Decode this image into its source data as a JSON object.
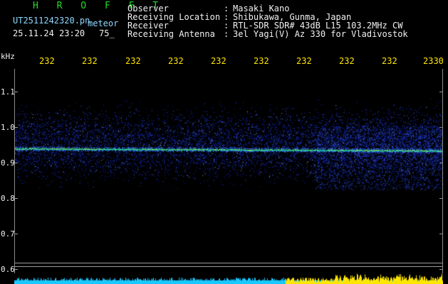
{
  "header": {
    "station_code": "H R O F F T",
    "filename": "UT2511242320.pn",
    "mode": "meteor",
    "datetime": "25.11.24 23:20",
    "count": "75_",
    "fields": [
      {
        "label": "Observer",
        "value": "Masaki Kano"
      },
      {
        "label": "Receiving Location",
        "value": "Shibukawa, Gunma, Japan"
      },
      {
        "label": "Receiver",
        "value": "RTL-SDR SDR# 43dB L15 103.2MHz CW"
      },
      {
        "label": "Receiving Antenna",
        "value": "3el Yagi(V) Az 330 for Vladivostok"
      }
    ],
    "separator": ":"
  },
  "axis": {
    "unit": "kHz",
    "y_ticks": [
      "1.1",
      "1.0",
      "0.9",
      "0.8",
      "0.7",
      "0.6"
    ],
    "time_ticks": [
      "232",
      "232",
      "232",
      "232",
      "232",
      "232",
      "232",
      "232",
      "232",
      "2330"
    ]
  },
  "colors": {
    "station_code": "#22dd22",
    "time_labels": "#ffe600",
    "signal_core": "#19e6b4",
    "noise": "#1a3cff",
    "power_bar": "#ffe600",
    "power_base": "#19c8ff"
  }
}
